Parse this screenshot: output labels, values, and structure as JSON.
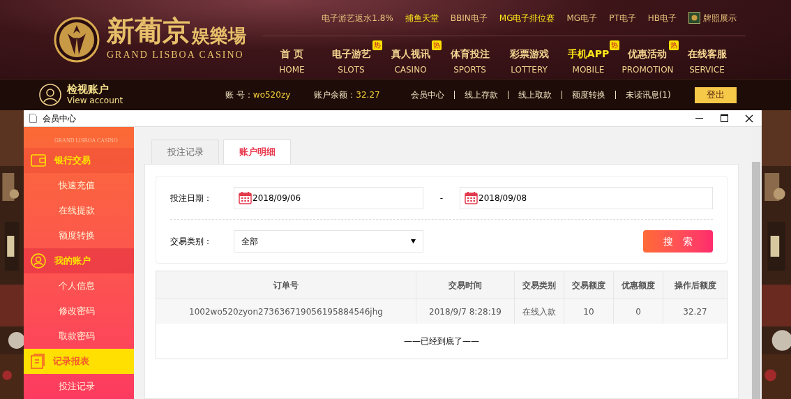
{
  "header": {
    "logo": {
      "title": "新葡京",
      "subtitle": "娱樂場",
      "english": "GRAND LISBOA CASINO"
    },
    "top_links": [
      {
        "label": "电子游艺返水1.8%",
        "highlight": false,
        "kind": "link"
      },
      {
        "label": "捕鱼天堂",
        "highlight": true,
        "kind": "link"
      },
      {
        "label": "BBIN电子",
        "highlight": false,
        "kind": "link"
      },
      {
        "label": "MG电子排位赛",
        "highlight": true,
        "kind": "link"
      },
      {
        "label": "MG电子",
        "highlight": false,
        "kind": "link"
      },
      {
        "label": "PT电子",
        "highlight": false,
        "kind": "link"
      },
      {
        "label": "HB电子",
        "highlight": false,
        "kind": "link"
      },
      {
        "label": "牌照展示",
        "highlight": false,
        "kind": "license"
      }
    ],
    "nav": [
      {
        "label": "首 页",
        "english": "HOME",
        "highlight": false
      },
      {
        "label": "电子游艺",
        "english": "SLOTS",
        "highlight": false,
        "badge": "热"
      },
      {
        "label": "真人视讯",
        "english": "CASINO",
        "highlight": false,
        "badge": "热"
      },
      {
        "label": "体育投注",
        "english": "SPORTS",
        "highlight": false
      },
      {
        "label": "彩票游戏",
        "english": "LOTTERY",
        "highlight": false
      },
      {
        "label": "手机APP",
        "english": "MOBILE",
        "highlight": true,
        "badge": "热"
      },
      {
        "label": "优惠活动",
        "english": "PROMOTION",
        "highlight": false,
        "badge": "热"
      },
      {
        "label": "在线客服",
        "english": "SERVICE",
        "highlight": false
      }
    ]
  },
  "account_bar": {
    "title": "检视账户",
    "subtitle": "View account",
    "account_label": "账 号：",
    "account": "wo520zy",
    "balance_label": "账户余额：",
    "balance": "32.27",
    "links": [
      "会员中心",
      "线上存款",
      "线上取款",
      "额度转换",
      "未读讯息(1)"
    ],
    "logout": "登出"
  },
  "window": {
    "title": "会员中心",
    "sidebar": {
      "logo_text": "GRAND LISBOA CASINO",
      "groups": [
        {
          "label": "银行交易",
          "kind": "wallet",
          "selected": false,
          "hover": false,
          "items": [
            "快速充值",
            "在线提款",
            "额度转换"
          ]
        },
        {
          "label": "我的账户",
          "kind": "user",
          "selected": false,
          "hover": true,
          "items": [
            "个人信息",
            "修改密码",
            "取款密码"
          ]
        },
        {
          "label": "记录报表",
          "kind": "report",
          "selected": true,
          "hover": false,
          "items": [
            "投注记录"
          ]
        }
      ]
    },
    "tabs": [
      {
        "label": "投注记录",
        "selected": false
      },
      {
        "label": "账户明细",
        "selected": true
      }
    ],
    "filters": {
      "date_label": "投注日期：",
      "date_from": "2018/09/06",
      "date_separator": "-",
      "date_to": "2018/09/08",
      "type_label": "交易类别：",
      "type_value": "全部",
      "search": "搜　索"
    },
    "table": {
      "columns": [
        "订单号",
        "交易时间",
        "交易类别",
        "交易额度",
        "优惠额度",
        "操作后额度"
      ],
      "rows": [
        [
          "1002wo520zyon273636719056195884546jhg",
          "2018/9/7 8:28:19",
          "在线入款",
          "10",
          "0",
          "32.27"
        ]
      ],
      "footer": "——已经到底了——"
    }
  }
}
